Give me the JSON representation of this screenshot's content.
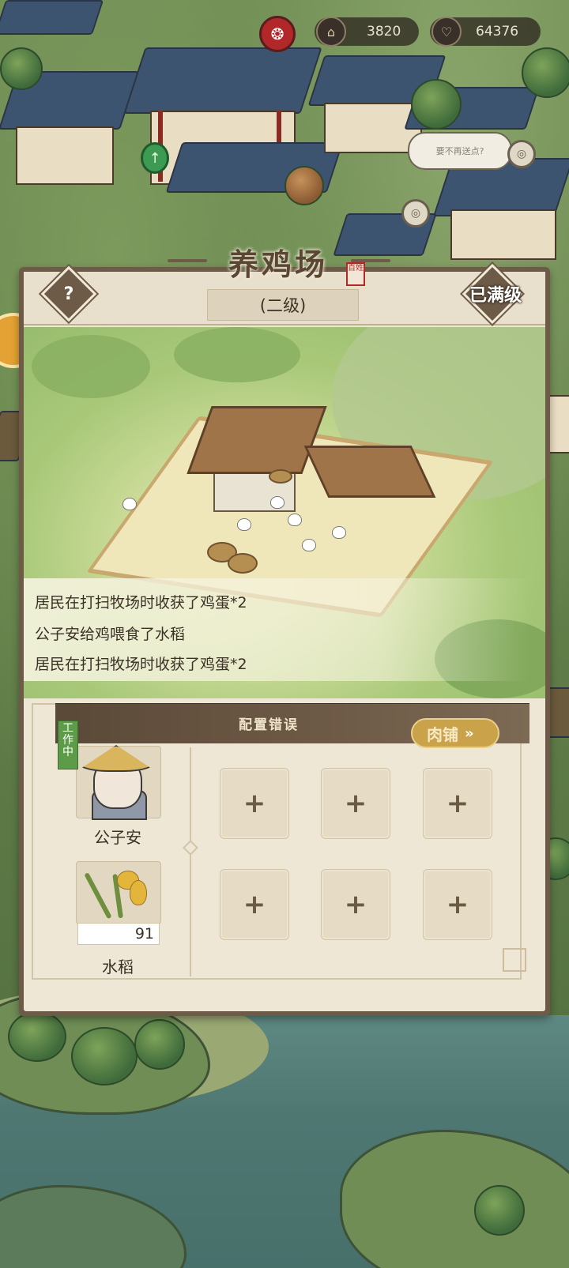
{
  "hud": {
    "prosperity_icon": "pavilion-icon",
    "prosperity_value": "3820",
    "favor_icon": "heart-icon",
    "favor_value": "64376",
    "red_icon": "fire-swirl-icon"
  },
  "map": {
    "bubble_text": "要不再送点?"
  },
  "panel": {
    "title": "养鸡场",
    "seal_text": "百姓",
    "level": "(二级)",
    "help_symbol": "?",
    "max_level": "已满级"
  },
  "log": [
    "居民在打扫牧场时收获了鸡蛋*2",
    "公子安给鸡喂食了水稻",
    "居民在打扫牧场时收获了鸡蛋*2"
  ],
  "work": {
    "title": "配置错误",
    "shop_button": "肉铺",
    "shop_arrow": "»",
    "status_tag": "工作中",
    "worker_name": "公子安",
    "feed_name": "水稻",
    "feed_qty": "91",
    "empty_slot_symbol": "+"
  },
  "colors": {
    "panel_border": "#6e5b47",
    "panel_bg": "#eee7d6",
    "status_green": "#5c9c48",
    "shop_gold": "#c9a249"
  }
}
